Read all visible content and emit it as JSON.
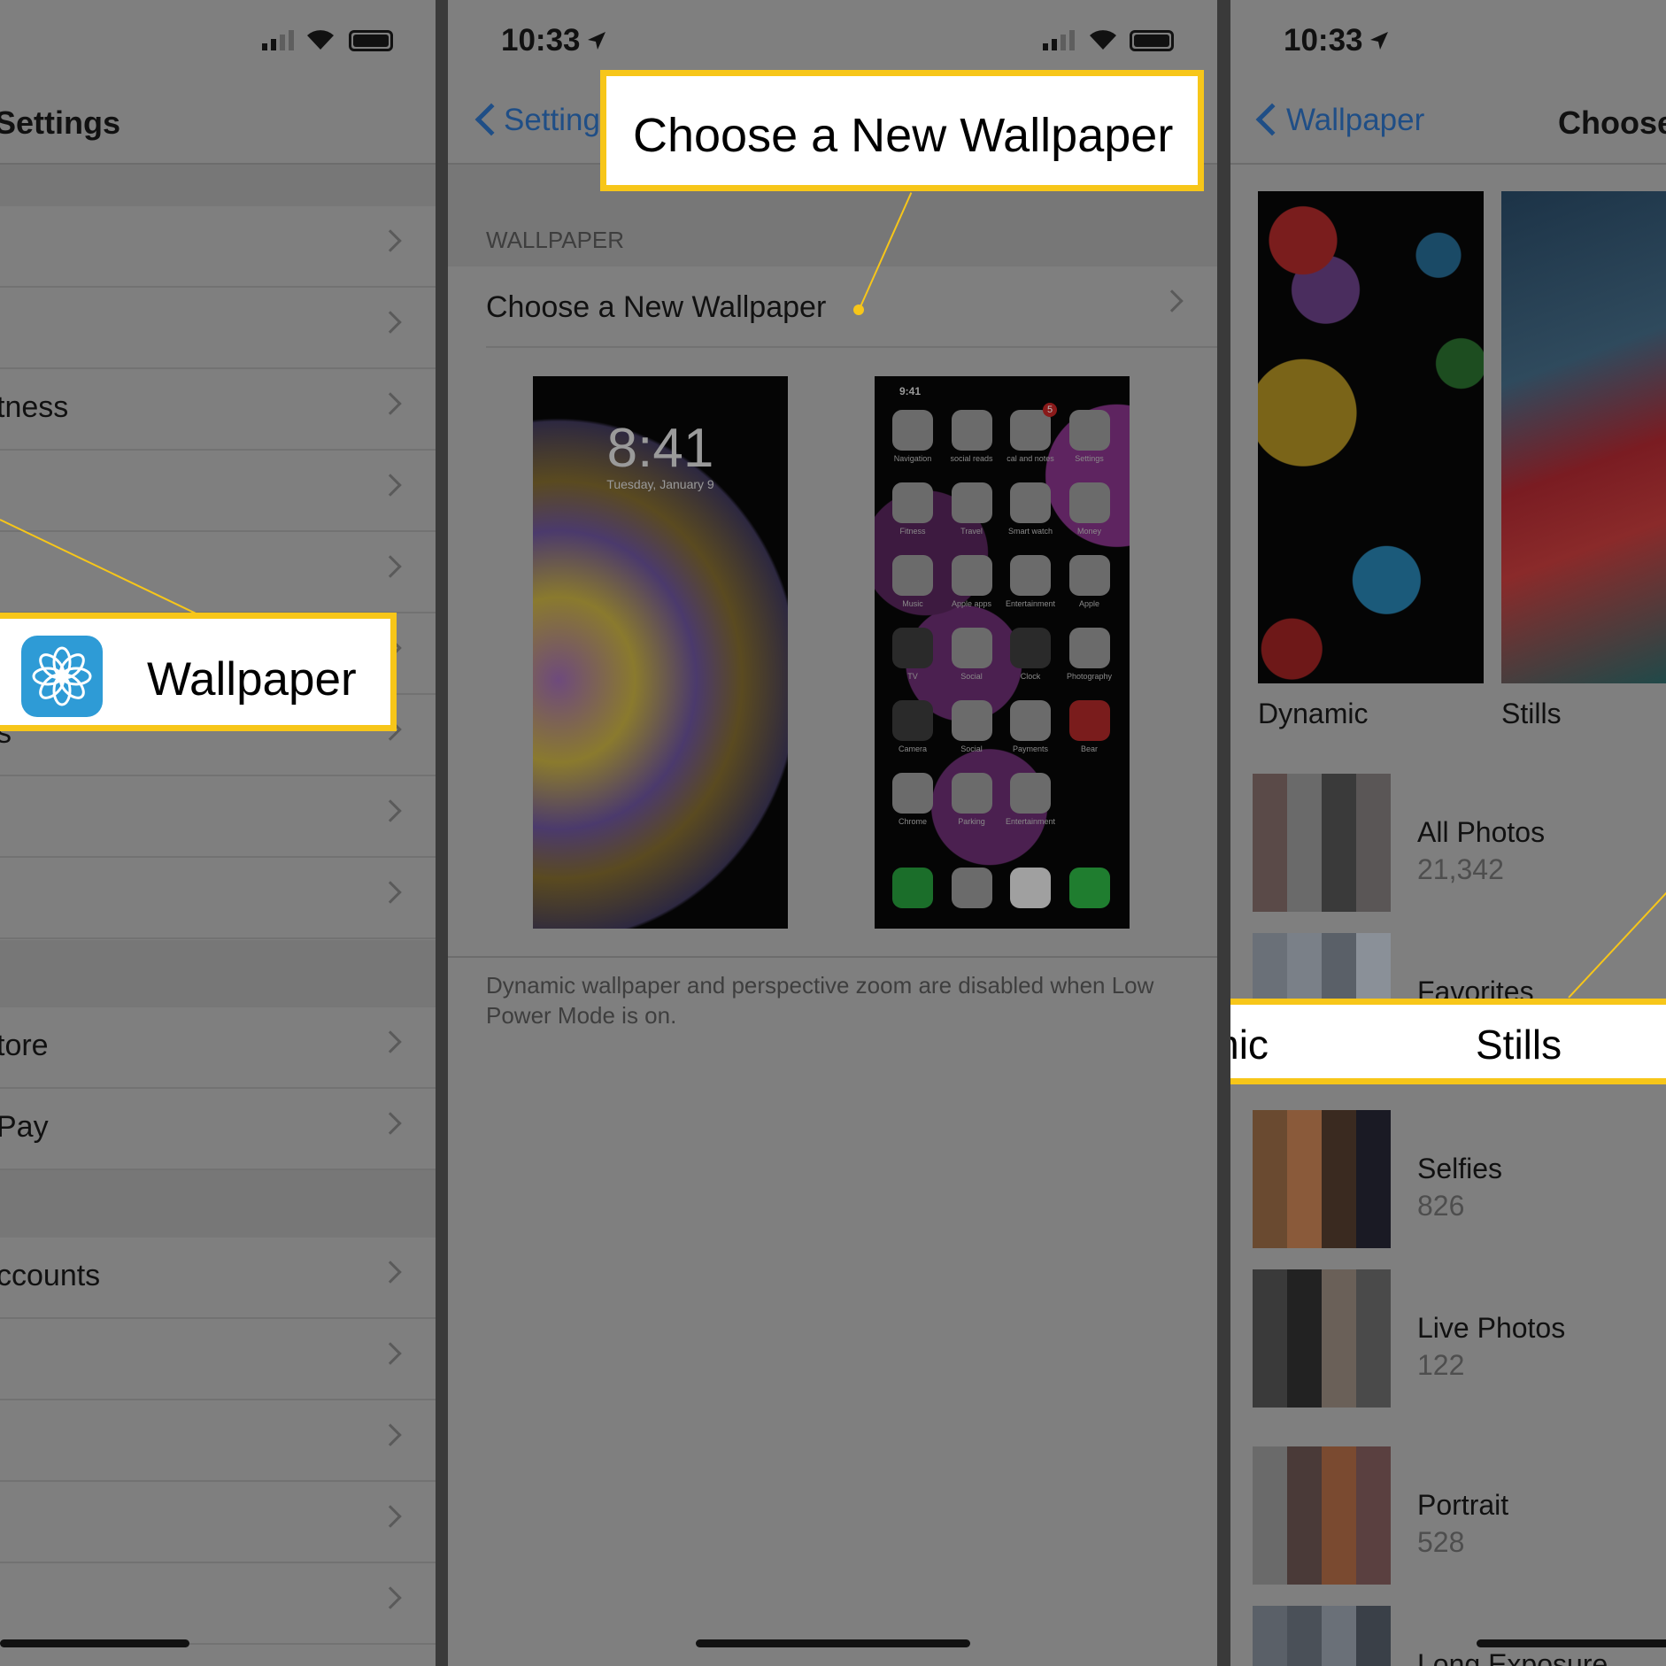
{
  "panel1": {
    "nav_title": "Settings",
    "rows": [
      "",
      "",
      "tness",
      "",
      "",
      "",
      "s",
      "",
      "",
      "tore",
      "Pay",
      "ccounts",
      "",
      "",
      "",
      ""
    ],
    "callout": {
      "label": "Wallpaper",
      "icon": "flower-icon",
      "icon_color": "#2e9bd6"
    }
  },
  "panel2": {
    "time": "10:33",
    "back_label": "Setting",
    "section_header": "WALLPAPER",
    "row_label": "Choose a New Wallpaper",
    "lock_preview": {
      "time": "8:41",
      "date": "Tuesday, January 9"
    },
    "home_preview": {
      "time": "9:41",
      "badge": "5",
      "apps": [
        "Navigation",
        "social reads",
        "cal and notes",
        "Settings",
        "Fitness",
        "Travel",
        "Smart watch",
        "Money",
        "Music",
        "Apple apps",
        "Entertainment",
        "Apple",
        "TV",
        "Social",
        "Clock",
        "Photography",
        "Camera",
        "Social",
        "Payments",
        "Bear",
        "Chrome",
        "Parking",
        "Entertainment"
      ]
    },
    "footer": "Dynamic wallpaper and perspective zoom are disabled when Low Power Mode is on.",
    "callout": {
      "label": "Choose a New Wallpaper"
    }
  },
  "panel3": {
    "time": "10:33",
    "back_label": "Wallpaper",
    "title": "Choose",
    "categories": [
      "Dynamic",
      "Stills"
    ],
    "albums": [
      {
        "title": "All Photos",
        "count": "21,342"
      },
      {
        "title": "Favorites",
        "count": ""
      },
      {
        "title": "Selfies",
        "count": "826"
      },
      {
        "title": "Live Photos",
        "count": "122"
      },
      {
        "title": "Portrait",
        "count": "528"
      },
      {
        "title": "Long Exposure",
        "count": ""
      }
    ],
    "callout": {
      "left": "Dynamic",
      "right": "Stills"
    }
  },
  "colors": {
    "highlight": "#f7c619",
    "ios_blue": "#1f4e86"
  }
}
